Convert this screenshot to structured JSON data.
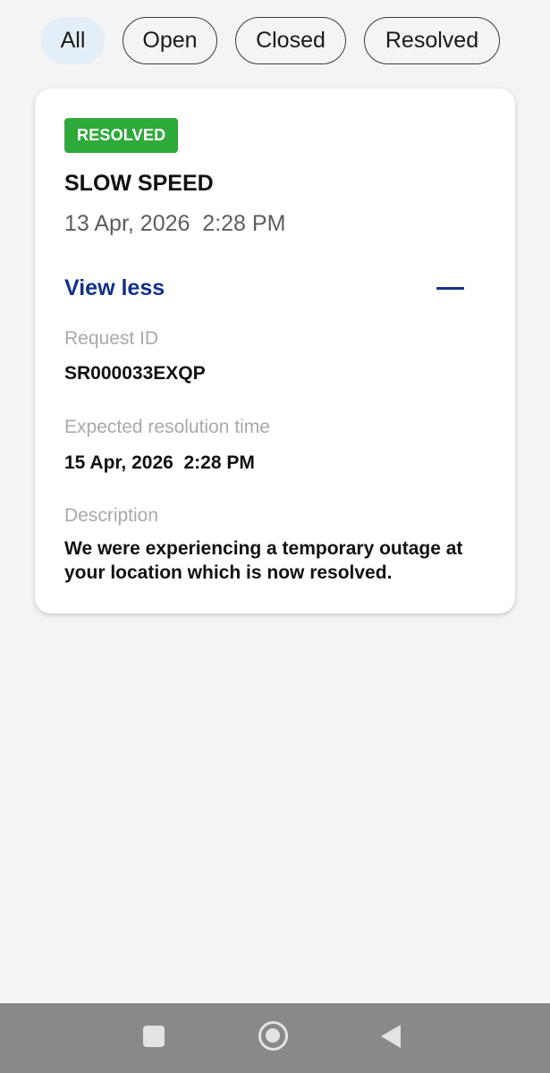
{
  "filters": {
    "all": "All",
    "open": "Open",
    "closed": "Closed",
    "resolved": "Resolved",
    "active": "All"
  },
  "ticket": {
    "status": "RESOLVED",
    "status_color": "#2eaa3a",
    "title": "SLOW SPEED",
    "created": "13 Apr, 2026  2:28 PM",
    "toggle_label": "View less",
    "request_id_label": "Request ID",
    "request_id": "SR000033EXQP",
    "expected_label": "Expected resolution time",
    "expected": "15 Apr, 2026  2:28 PM",
    "description_label": "Description",
    "description": "We were experiencing a temporary outage at your location which is now resolved."
  },
  "colors": {
    "accent": "#12318a",
    "active_chip": "#e3eef6",
    "background": "#f4f4f4",
    "navbar": "#898989"
  },
  "navbar": {
    "icons": [
      "recents-square-icon",
      "home-circle-icon",
      "back-triangle-icon"
    ]
  }
}
